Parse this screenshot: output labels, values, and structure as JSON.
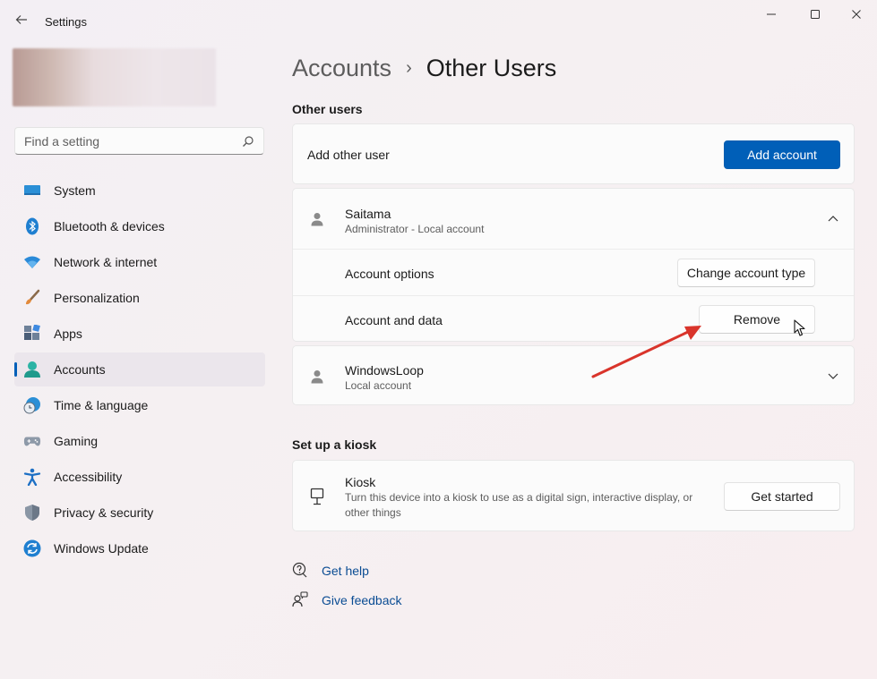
{
  "window": {
    "title": "Settings"
  },
  "sidebar": {
    "search_placeholder": "Find a setting",
    "items": [
      {
        "label": "System",
        "icon": "system-icon"
      },
      {
        "label": "Bluetooth & devices",
        "icon": "bluetooth-icon"
      },
      {
        "label": "Network & internet",
        "icon": "wifi-icon"
      },
      {
        "label": "Personalization",
        "icon": "brush-icon"
      },
      {
        "label": "Apps",
        "icon": "apps-icon"
      },
      {
        "label": "Accounts",
        "icon": "accounts-icon",
        "selected": true
      },
      {
        "label": "Time & language",
        "icon": "globe-clock-icon"
      },
      {
        "label": "Gaming",
        "icon": "gamepad-icon"
      },
      {
        "label": "Accessibility",
        "icon": "accessibility-icon"
      },
      {
        "label": "Privacy & security",
        "icon": "shield-icon"
      },
      {
        "label": "Windows Update",
        "icon": "update-icon"
      }
    ]
  },
  "breadcrumb": {
    "parent": "Accounts",
    "separator": "›",
    "current": "Other Users"
  },
  "other_users": {
    "section_title": "Other users",
    "add_other_user_label": "Add other user",
    "add_account_button": "Add account",
    "users": [
      {
        "name": "Saitama",
        "subtitle": "Administrator - Local account",
        "expanded": true,
        "account_options_label": "Account options",
        "change_type_button": "Change account type",
        "account_data_label": "Account and data",
        "remove_button": "Remove"
      },
      {
        "name": "WindowsLoop",
        "subtitle": "Local account",
        "expanded": false
      }
    ]
  },
  "kiosk": {
    "section_title": "Set up a kiosk",
    "title": "Kiosk",
    "description_line1": "Turn this device into a kiosk to use as a digital sign, interactive display, or",
    "description_line2": "other things",
    "button": "Get started"
  },
  "help_links": {
    "get_help": "Get help",
    "give_feedback": "Give feedback"
  },
  "colors": {
    "accent": "#005fb8",
    "annotation_arrow": "#d9342b"
  }
}
